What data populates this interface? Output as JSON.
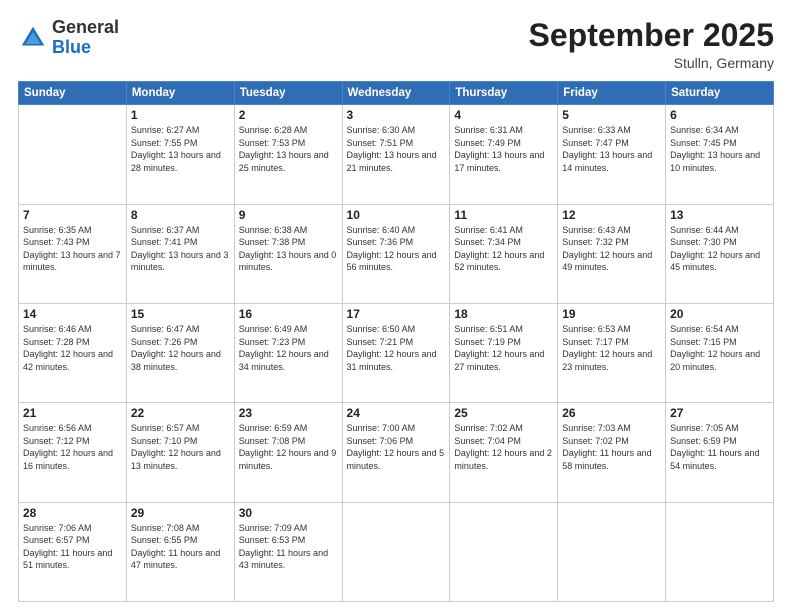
{
  "header": {
    "logo": {
      "general": "General",
      "blue": "Blue"
    },
    "title": "September 2025",
    "location": "Stulln, Germany"
  },
  "columns": [
    "Sunday",
    "Monday",
    "Tuesday",
    "Wednesday",
    "Thursday",
    "Friday",
    "Saturday"
  ],
  "weeks": [
    [
      {
        "day": "",
        "info": ""
      },
      {
        "day": "1",
        "info": "Sunrise: 6:27 AM\nSunset: 7:55 PM\nDaylight: 13 hours and 28 minutes."
      },
      {
        "day": "2",
        "info": "Sunrise: 6:28 AM\nSunset: 7:53 PM\nDaylight: 13 hours and 25 minutes."
      },
      {
        "day": "3",
        "info": "Sunrise: 6:30 AM\nSunset: 7:51 PM\nDaylight: 13 hours and 21 minutes."
      },
      {
        "day": "4",
        "info": "Sunrise: 6:31 AM\nSunset: 7:49 PM\nDaylight: 13 hours and 17 minutes."
      },
      {
        "day": "5",
        "info": "Sunrise: 6:33 AM\nSunset: 7:47 PM\nDaylight: 13 hours and 14 minutes."
      },
      {
        "day": "6",
        "info": "Sunrise: 6:34 AM\nSunset: 7:45 PM\nDaylight: 13 hours and 10 minutes."
      }
    ],
    [
      {
        "day": "7",
        "info": "Sunrise: 6:35 AM\nSunset: 7:43 PM\nDaylight: 13 hours and 7 minutes."
      },
      {
        "day": "8",
        "info": "Sunrise: 6:37 AM\nSunset: 7:41 PM\nDaylight: 13 hours and 3 minutes."
      },
      {
        "day": "9",
        "info": "Sunrise: 6:38 AM\nSunset: 7:38 PM\nDaylight: 13 hours and 0 minutes."
      },
      {
        "day": "10",
        "info": "Sunrise: 6:40 AM\nSunset: 7:36 PM\nDaylight: 12 hours and 56 minutes."
      },
      {
        "day": "11",
        "info": "Sunrise: 6:41 AM\nSunset: 7:34 PM\nDaylight: 12 hours and 52 minutes."
      },
      {
        "day": "12",
        "info": "Sunrise: 6:43 AM\nSunset: 7:32 PM\nDaylight: 12 hours and 49 minutes."
      },
      {
        "day": "13",
        "info": "Sunrise: 6:44 AM\nSunset: 7:30 PM\nDaylight: 12 hours and 45 minutes."
      }
    ],
    [
      {
        "day": "14",
        "info": "Sunrise: 6:46 AM\nSunset: 7:28 PM\nDaylight: 12 hours and 42 minutes."
      },
      {
        "day": "15",
        "info": "Sunrise: 6:47 AM\nSunset: 7:26 PM\nDaylight: 12 hours and 38 minutes."
      },
      {
        "day": "16",
        "info": "Sunrise: 6:49 AM\nSunset: 7:23 PM\nDaylight: 12 hours and 34 minutes."
      },
      {
        "day": "17",
        "info": "Sunrise: 6:50 AM\nSunset: 7:21 PM\nDaylight: 12 hours and 31 minutes."
      },
      {
        "day": "18",
        "info": "Sunrise: 6:51 AM\nSunset: 7:19 PM\nDaylight: 12 hours and 27 minutes."
      },
      {
        "day": "19",
        "info": "Sunrise: 6:53 AM\nSunset: 7:17 PM\nDaylight: 12 hours and 23 minutes."
      },
      {
        "day": "20",
        "info": "Sunrise: 6:54 AM\nSunset: 7:15 PM\nDaylight: 12 hours and 20 minutes."
      }
    ],
    [
      {
        "day": "21",
        "info": "Sunrise: 6:56 AM\nSunset: 7:12 PM\nDaylight: 12 hours and 16 minutes."
      },
      {
        "day": "22",
        "info": "Sunrise: 6:57 AM\nSunset: 7:10 PM\nDaylight: 12 hours and 13 minutes."
      },
      {
        "day": "23",
        "info": "Sunrise: 6:59 AM\nSunset: 7:08 PM\nDaylight: 12 hours and 9 minutes."
      },
      {
        "day": "24",
        "info": "Sunrise: 7:00 AM\nSunset: 7:06 PM\nDaylight: 12 hours and 5 minutes."
      },
      {
        "day": "25",
        "info": "Sunrise: 7:02 AM\nSunset: 7:04 PM\nDaylight: 12 hours and 2 minutes."
      },
      {
        "day": "26",
        "info": "Sunrise: 7:03 AM\nSunset: 7:02 PM\nDaylight: 11 hours and 58 minutes."
      },
      {
        "day": "27",
        "info": "Sunrise: 7:05 AM\nSunset: 6:59 PM\nDaylight: 11 hours and 54 minutes."
      }
    ],
    [
      {
        "day": "28",
        "info": "Sunrise: 7:06 AM\nSunset: 6:57 PM\nDaylight: 11 hours and 51 minutes."
      },
      {
        "day": "29",
        "info": "Sunrise: 7:08 AM\nSunset: 6:55 PM\nDaylight: 11 hours and 47 minutes."
      },
      {
        "day": "30",
        "info": "Sunrise: 7:09 AM\nSunset: 6:53 PM\nDaylight: 11 hours and 43 minutes."
      },
      {
        "day": "",
        "info": ""
      },
      {
        "day": "",
        "info": ""
      },
      {
        "day": "",
        "info": ""
      },
      {
        "day": "",
        "info": ""
      }
    ]
  ]
}
